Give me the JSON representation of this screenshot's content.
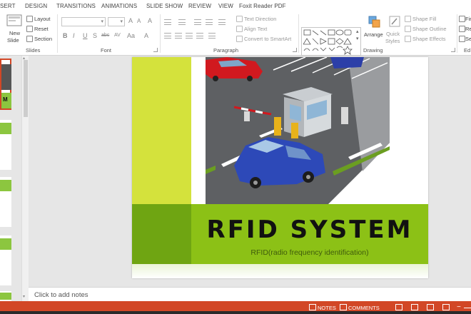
{
  "tabs": [
    "SERT",
    "DESIGN",
    "TRANSITIONS",
    "ANIMATIONS",
    "SLIDE SHOW",
    "REVIEW",
    "VIEW",
    "Foxit Reader PDF"
  ],
  "ribbon": {
    "slides_group": {
      "new_slide": "New",
      "new_slide2": "Slide",
      "layout": "Layout",
      "reset": "Reset",
      "section": "Section",
      "label": "Slides"
    },
    "font_group": {
      "bold": "B",
      "italic": "I",
      "underline": "U",
      "shadow": "S",
      "strike": "abc",
      "spacing": "AV",
      "case": "Aa",
      "grow": "A",
      "shrink": "A",
      "clear": "A",
      "color": "A",
      "label": "Font"
    },
    "paragraph_group": {
      "text_direction": "Text Direction",
      "align_text": "Align Text",
      "smartart": "Convert to SmartArt",
      "label": "Paragraph"
    },
    "drawing_group": {
      "arrange": "Arrange",
      "quick": "Quick",
      "styles": "Styles",
      "shape_fill": "Shape Fill",
      "shape_outline": "Shape Outline",
      "shape_effects": "Shape Effects",
      "label": "Drawing"
    },
    "editing_group": {
      "find": "Fir",
      "replace": "Re",
      "select": "Sel",
      "label": "Ed"
    }
  },
  "slide": {
    "title": "RFID SYSTEM",
    "subtitle": "RFID(radio frequency identification)"
  },
  "notes_placeholder": "Click to add notes",
  "status": {
    "notes": "NOTES",
    "comments": "COMMENTS"
  },
  "colors": {
    "accent": "#d24726",
    "slide_green": "#8cc116",
    "slide_yellow": "#d4e23c"
  }
}
